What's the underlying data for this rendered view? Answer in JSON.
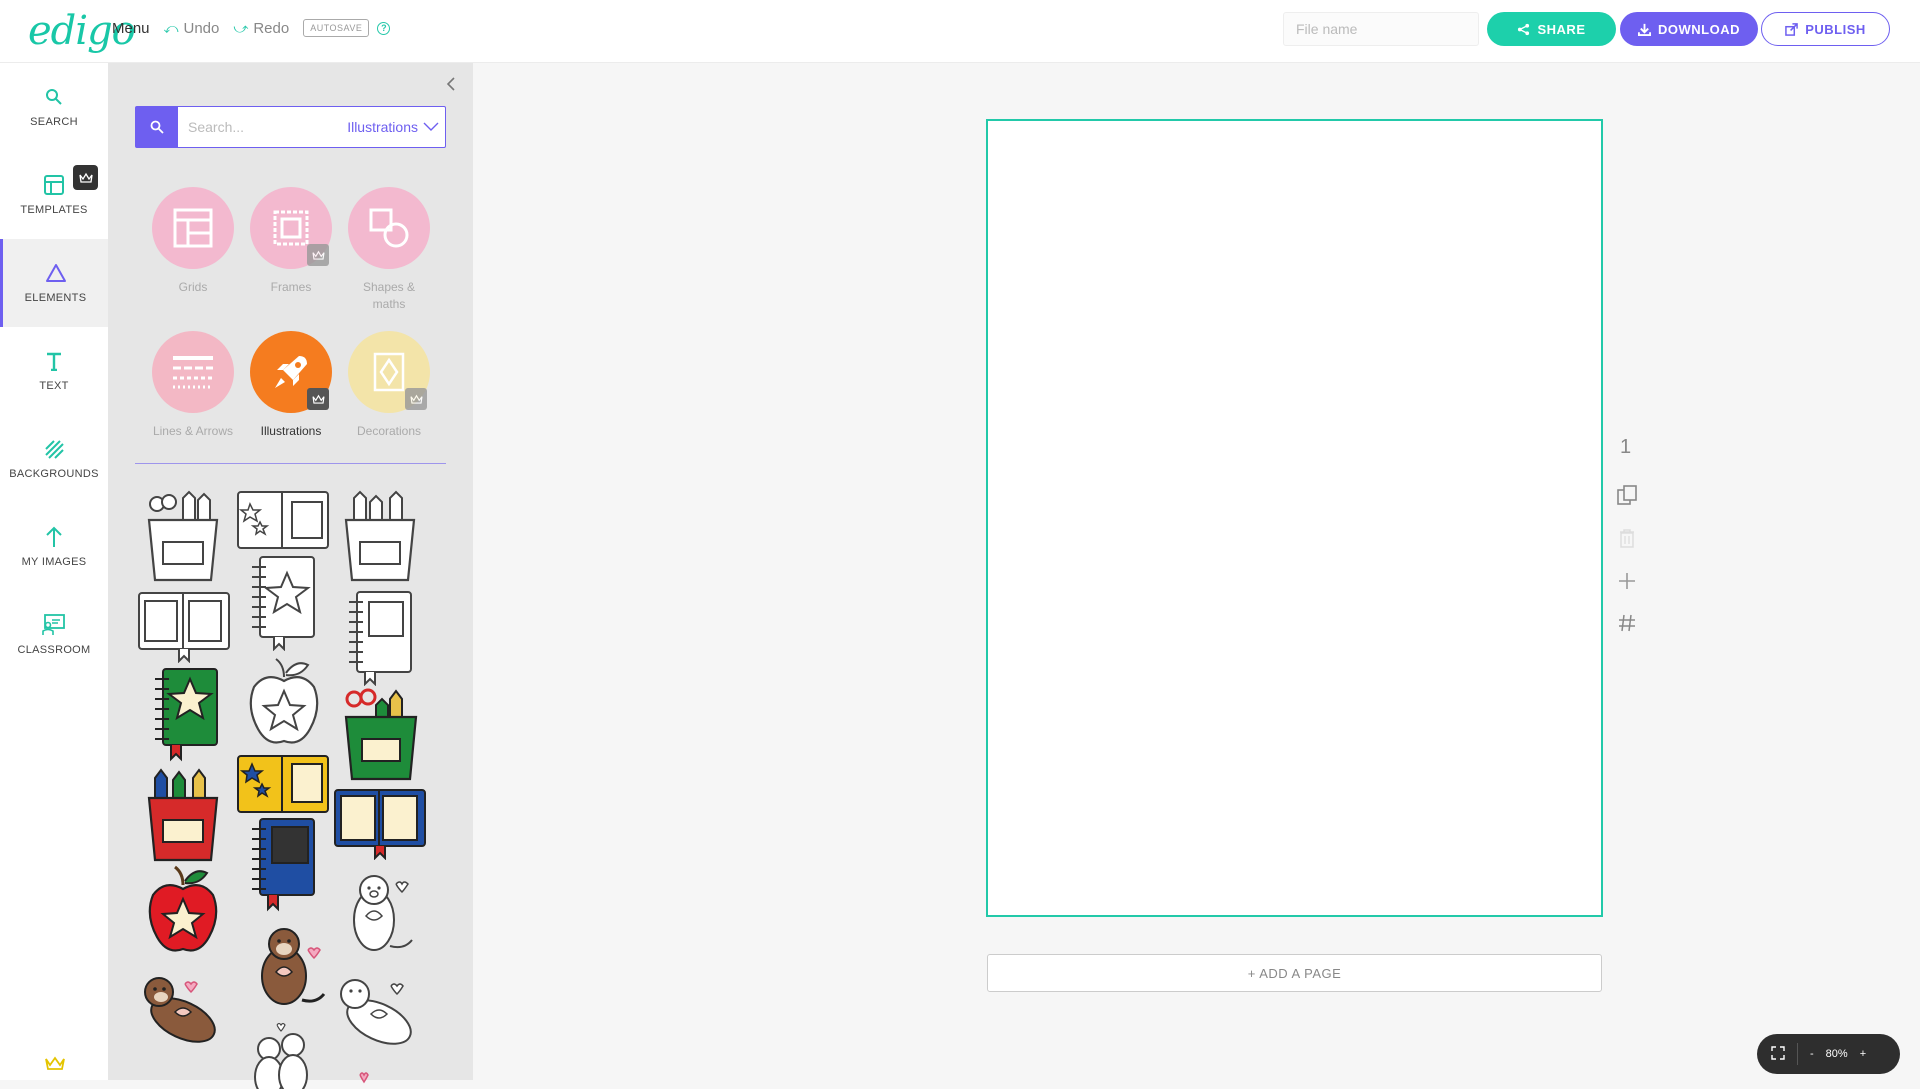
{
  "app": {
    "logo": "edigo"
  },
  "topbar": {
    "menu_label": "Menu",
    "undo_label": "Undo",
    "redo_label": "Redo",
    "autosave_label": "AUTOSAVE",
    "filename_placeholder": "File name",
    "share_label": "SHARE",
    "download_label": "DOWNLOAD",
    "publish_label": "PUBLISH"
  },
  "rail": {
    "items": [
      {
        "label": "SEARCH",
        "icon": "search-icon"
      },
      {
        "label": "TEMPLATES",
        "icon": "template-icon",
        "premium": true
      },
      {
        "label": "ELEMENTS",
        "icon": "triangle-icon",
        "active": true
      },
      {
        "label": "TEXT",
        "icon": "text-icon"
      },
      {
        "label": "BACKGROUNDS",
        "icon": "stripes-icon"
      },
      {
        "label": "MY IMAGES",
        "icon": "upload-arrow-icon"
      },
      {
        "label": "CLASSROOM",
        "icon": "classroom-icon"
      }
    ]
  },
  "panel": {
    "search_placeholder": "Search...",
    "search_category": "Illustrations",
    "categories": [
      {
        "label": "Grids",
        "color": "#f4b8cf"
      },
      {
        "label": "Frames",
        "color": "#f4b8cf",
        "premium": true
      },
      {
        "label": "Shapes & maths",
        "color": "#f4b8cf"
      },
      {
        "label": "Lines & Arrows",
        "color": "#f4b8c4"
      },
      {
        "label": "Illustrations",
        "color": "#f57c1f",
        "premium": true,
        "active": true
      },
      {
        "label": "Decorations",
        "color": "#f4e4a8",
        "premium": true
      }
    ]
  },
  "canvas": {
    "page_number": "1",
    "add_page_label": "+ ADD A PAGE"
  },
  "zoom": {
    "level": "80%",
    "minus": "-",
    "plus": "+"
  },
  "colors": {
    "accent": "#1dd0ab",
    "brand": "#6e5ff0"
  }
}
